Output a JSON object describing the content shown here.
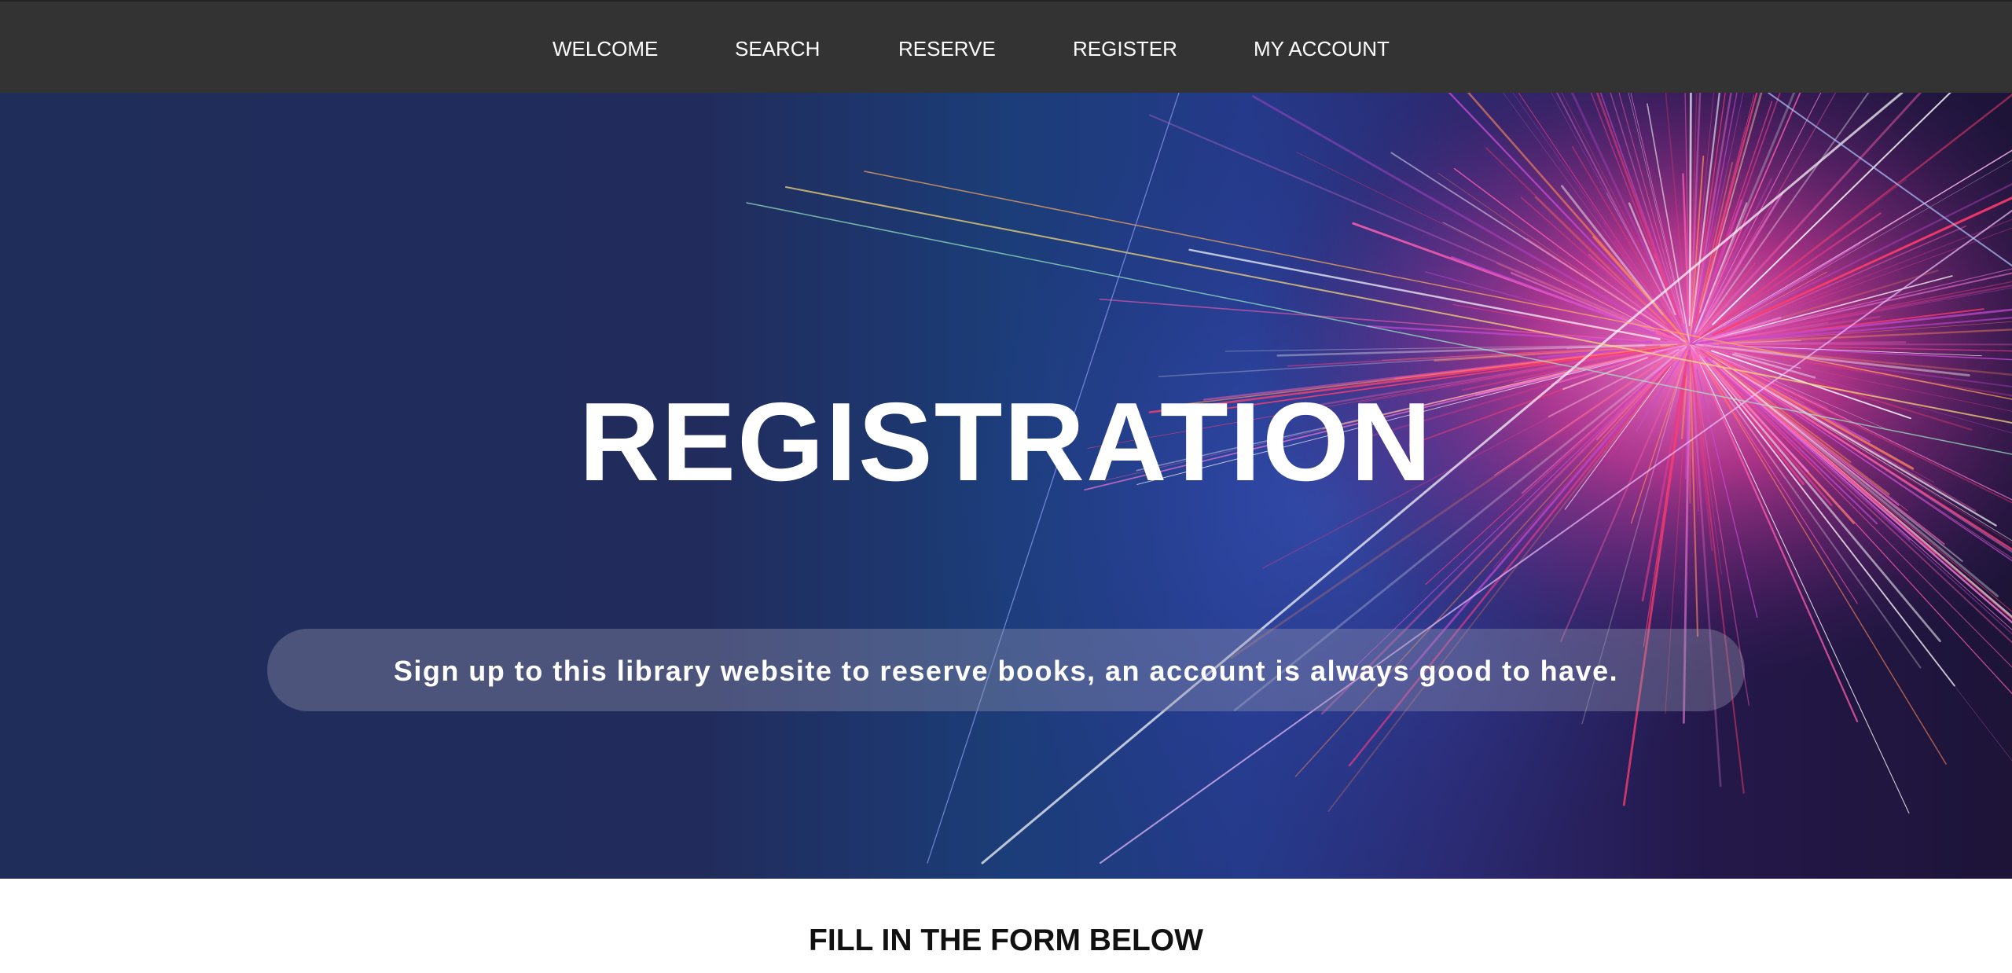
{
  "nav": {
    "items": [
      {
        "label": "WELCOME"
      },
      {
        "label": "SEARCH"
      },
      {
        "label": "RESERVE"
      },
      {
        "label": "REGISTER"
      },
      {
        "label": "MY ACCOUNT"
      }
    ]
  },
  "hero": {
    "title": "REGISTRATION",
    "subtitle": "Sign up to this library website to reserve books, an account is always good to have.",
    "background_image": "abstract-light-burst"
  },
  "form": {
    "heading": "FILL IN THE FORM BELOW"
  },
  "colors": {
    "nav_background": "#333333",
    "nav_text": "#ffffff",
    "hero_background": "#1f2d5a",
    "hero_accent": "#e0409a",
    "heading_text": "#111111"
  }
}
